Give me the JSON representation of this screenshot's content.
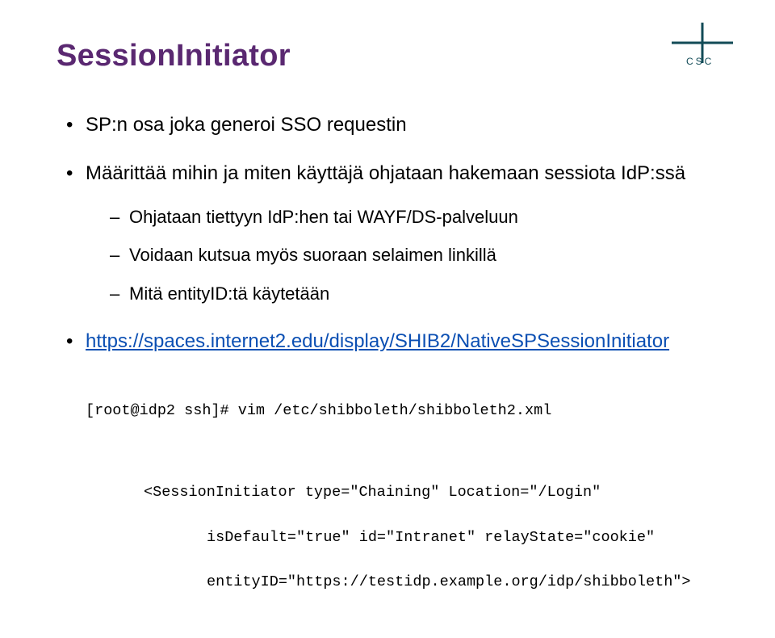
{
  "title": "SessionInitiator",
  "bullets": {
    "b1": "SP:n osa joka generoi SSO requestin",
    "b2": "Määrittää mihin ja miten käyttäjä ohjataan hakemaan sessiota IdP:ssä",
    "b2_sub": {
      "s1": "Ohjataan tiettyyn IdP:hen tai WAYF/DS-palveluun",
      "s2": "Voidaan kutsua myös suoraan selaimen linkillä",
      "s3": "Mitä entityID:tä käytetään"
    },
    "b3_link": "https://spaces.internet2.edu/display/SHIB2/NativeSPSessionInitiator"
  },
  "code": {
    "l1": "[root@idp2 ssh]# vim /etc/shibboleth/shibboleth2.xml",
    "l2": "<SessionInitiator type=\"Chaining\" Location=\"/Login\"",
    "l3": "isDefault=\"true\" id=\"Intranet\" relayState=\"cookie\"",
    "l4": "entityID=\"https://testidp.example.org/idp/shibboleth\">"
  },
  "logo": {
    "label": "CSC"
  }
}
